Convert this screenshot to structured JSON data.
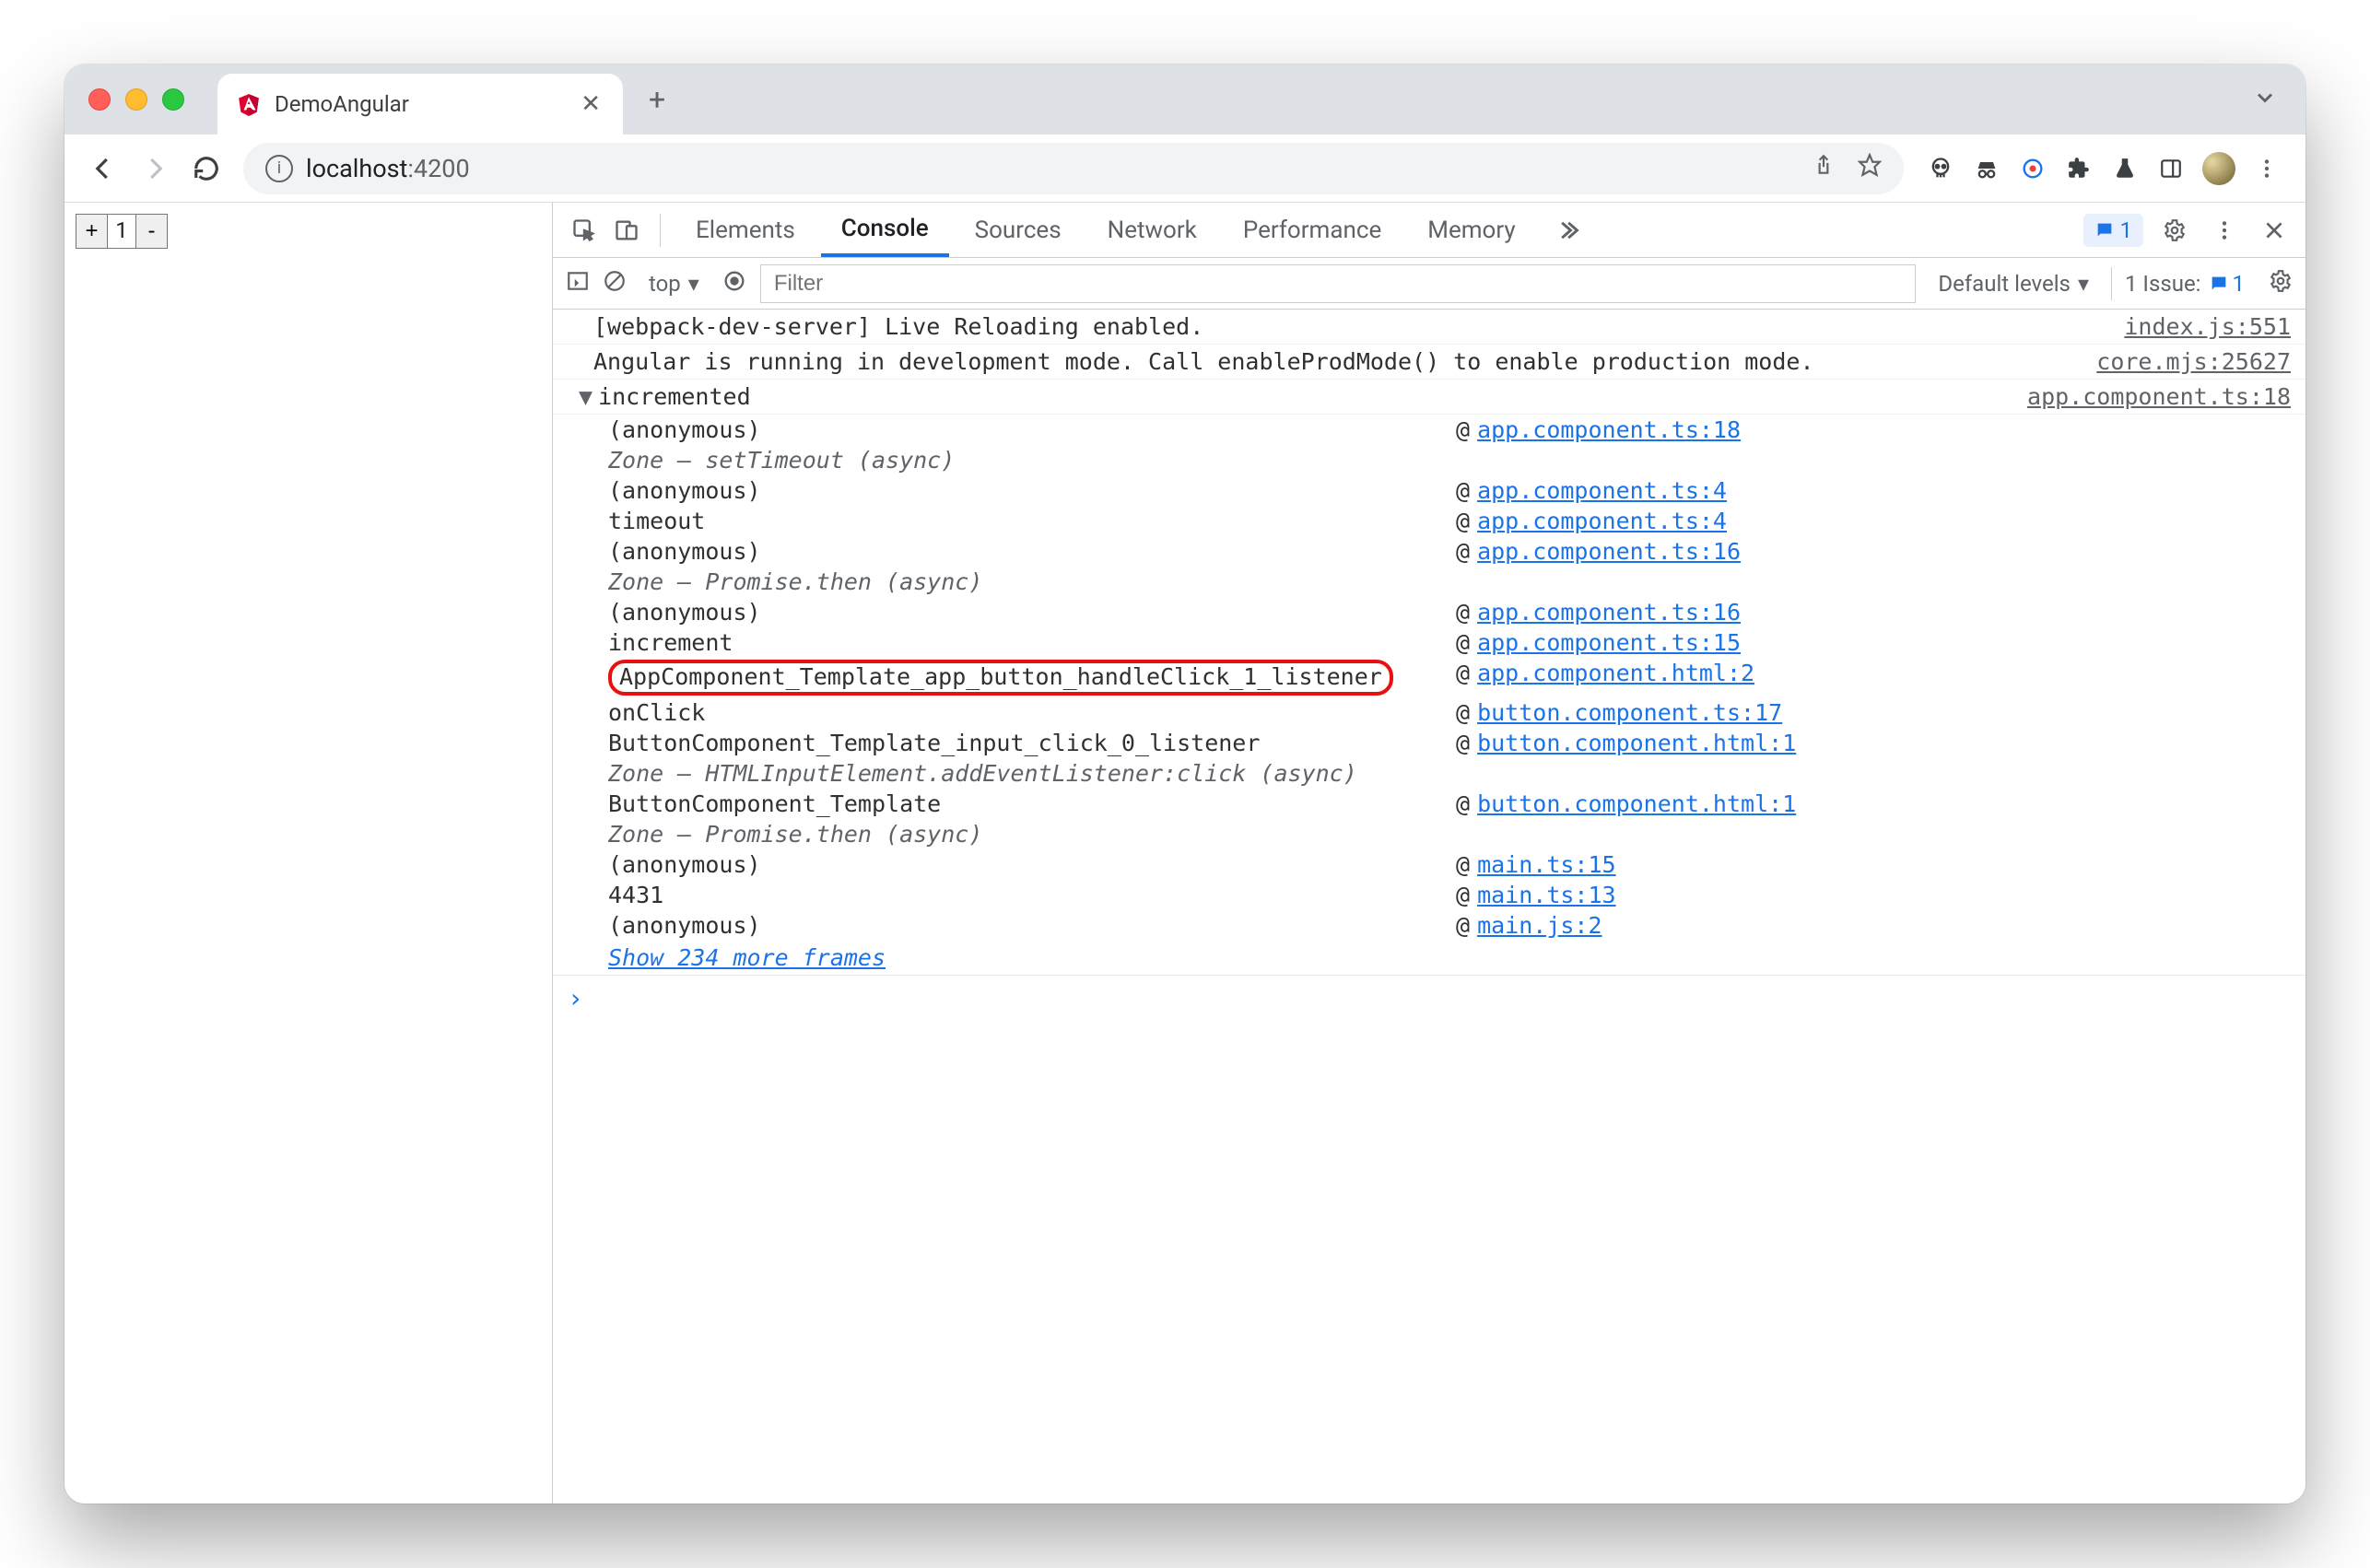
{
  "browser": {
    "tab_title": "DemoAngular",
    "url_host": "localhost",
    "url_path": ":4200",
    "counter_value": "1"
  },
  "devtools": {
    "tabs": [
      "Elements",
      "Console",
      "Sources",
      "Network",
      "Performance",
      "Memory"
    ],
    "active_tab": "Console",
    "issues_count": "1",
    "badge_count": "1",
    "context": "top",
    "filter_placeholder": "Filter",
    "levels_label": "Default levels",
    "issue_label": "1 Issue:"
  },
  "console": {
    "rows": [
      {
        "msg": "[webpack-dev-server] Live Reloading enabled.",
        "src": "index.js:551"
      },
      {
        "msg": "Angular is running in development mode. Call enableProdMode() to enable production mode.",
        "src": "core.mjs:25627"
      }
    ],
    "group_label": "incremented",
    "group_src": "app.component.ts:18",
    "stack": [
      {
        "fn": "(anonymous)",
        "loc": "app.component.ts:18"
      },
      {
        "fn": "Zone — setTimeout (async)",
        "italic": true
      },
      {
        "fn": "(anonymous)",
        "loc": "app.component.ts:4"
      },
      {
        "fn": "timeout",
        "loc": "app.component.ts:4"
      },
      {
        "fn": "(anonymous)",
        "loc": "app.component.ts:16"
      },
      {
        "fn": "Zone — Promise.then (async)",
        "italic": true
      },
      {
        "fn": "(anonymous)",
        "loc": "app.component.ts:16"
      },
      {
        "fn": "increment",
        "loc": "app.component.ts:15"
      },
      {
        "fn": "AppComponent_Template_app_button_handleClick_1_listener",
        "loc": "app.component.html:2",
        "circled": true
      },
      {
        "fn": "onClick",
        "loc": "button.component.ts:17"
      },
      {
        "fn": "ButtonComponent_Template_input_click_0_listener",
        "loc": "button.component.html:1"
      },
      {
        "fn": "Zone — HTMLInputElement.addEventListener:click (async)",
        "italic": true
      },
      {
        "fn": "ButtonComponent_Template",
        "loc": "button.component.html:1"
      },
      {
        "fn": "Zone — Promise.then (async)",
        "italic": true
      },
      {
        "fn": "(anonymous)",
        "loc": "main.ts:15"
      },
      {
        "fn": "4431",
        "loc": "main.ts:13"
      },
      {
        "fn": "(anonymous)",
        "loc": "main.js:2"
      }
    ],
    "show_more": "Show 234 more frames"
  }
}
